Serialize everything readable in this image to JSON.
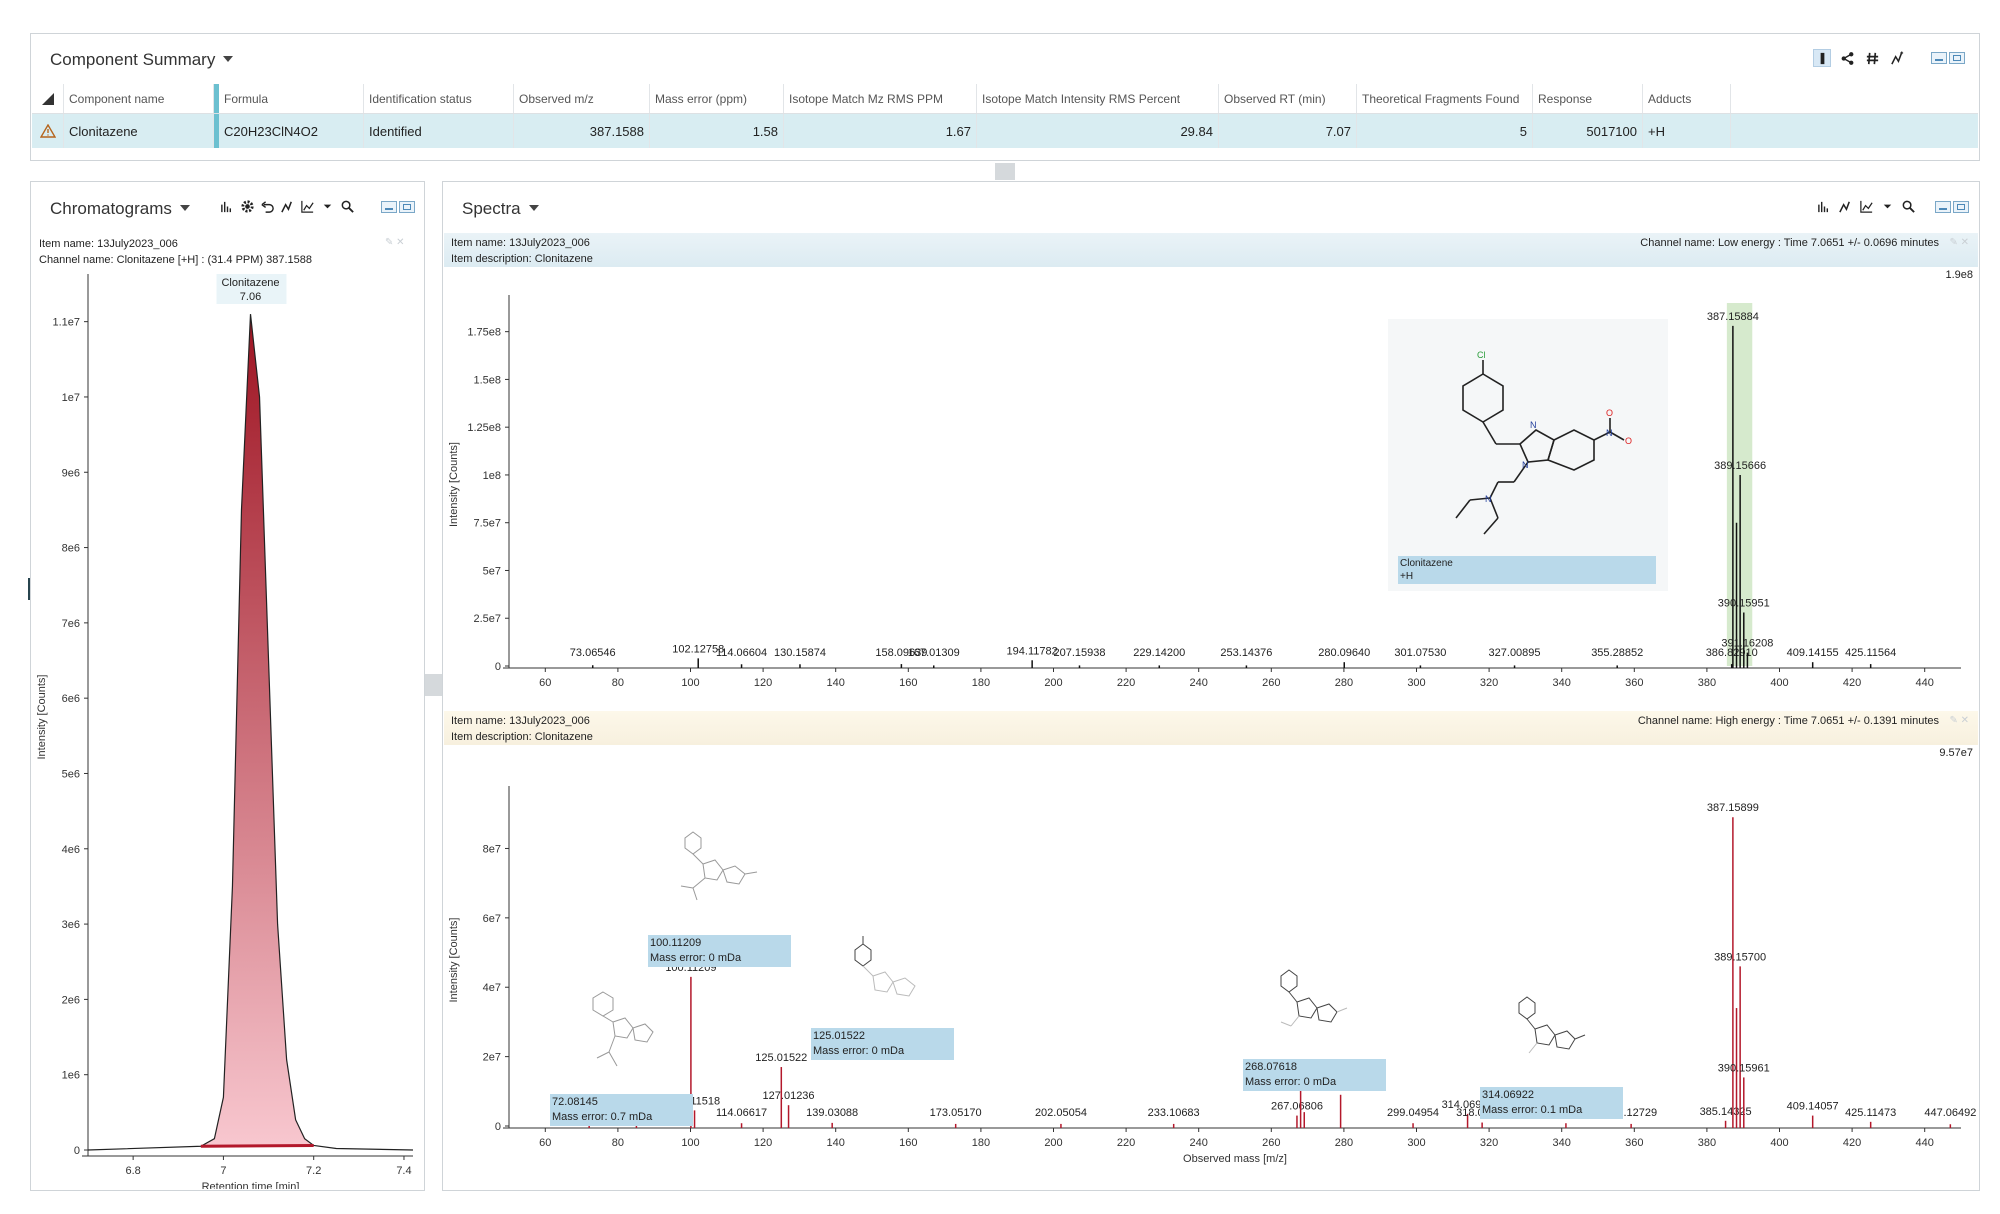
{
  "component_summary": {
    "title": "Component Summary",
    "columns": [
      "Component name",
      "Formula",
      "Identification status",
      "Observed m/z",
      "Mass error (ppm)",
      "Isotope Match Mz RMS PPM",
      "Isotope Match Intensity RMS Percent",
      "Observed RT (min)",
      "Theoretical Fragments Found",
      "Response",
      "Adducts"
    ],
    "row": {
      "name": "Clonitazene",
      "formula": "C20H23ClN4O2",
      "status": "Identified",
      "observed_mz": "387.1588",
      "mass_error": "1.58",
      "iso_mz": "1.67",
      "iso_int": "29.84",
      "rt": "7.07",
      "fragments": "5",
      "response": "5017100",
      "adducts": "+H"
    },
    "toolbar_icons": [
      "flask-icon",
      "share-icon",
      "hash-icon",
      "structure-icon"
    ]
  },
  "chromatograms": {
    "title": "Chromatograms",
    "item_name": "Item name: 13July2023_006",
    "channel_name": "Channel name: Clonitazene [+H] : (31.4 PPM) 387.1588",
    "peak_label": "Clonitazene",
    "peak_rt": "7.06",
    "ylabel": "Intensity [Counts]",
    "xlabel": "Retention time [min]"
  },
  "spectra": {
    "title": "Spectra",
    "low": {
      "item_name": "Item name: 13July2023_006",
      "item_desc": "Item description: Clonitazene",
      "channel": "Channel name: Low energy : Time 7.0651 +/- 0.0696 minutes",
      "max_label": "1.9e8",
      "ylabel": "Intensity [Counts]",
      "struct_label_1": "Clonitazene",
      "struct_label_2": "+H"
    },
    "high": {
      "item_name": "Item name: 13July2023_006",
      "item_desc": "Item description: Clonitazene",
      "channel": "Channel name: High energy : Time 7.0651 +/- 0.1391 minutes",
      "max_label": "9.57e7",
      "ylabel": "Intensity [Counts]",
      "xlabel": "Observed mass [m/z]",
      "callouts": [
        {
          "mz": "72.08145",
          "err": "Mass error: 0.7 mDa"
        },
        {
          "mz": "100.11209",
          "err": "Mass error: 0 mDa"
        },
        {
          "mz": "125.01522",
          "err": "Mass error: 0 mDa"
        },
        {
          "mz": "268.07618",
          "err": "Mass error: 0 mDa"
        },
        {
          "mz": "314.06922",
          "err": "Mass error: 0.1 mDa"
        }
      ]
    }
  },
  "chart_data": [
    {
      "type": "line",
      "title": "",
      "xlabel": "Retention time [min]",
      "ylabel": "Intensity [Counts]",
      "xlim": [
        6.7,
        7.42
      ],
      "ylim": [
        0,
        11500000
      ],
      "xticks": [
        "6.8",
        "7",
        "7.2",
        "7.4"
      ],
      "yticks": [
        "0",
        "1e6",
        "2e6",
        "3e6",
        "4e6",
        "5e6",
        "6e6",
        "7e6",
        "8e6",
        "9e6",
        "1e7",
        "1.1e7"
      ],
      "x": [
        6.7,
        6.95,
        6.98,
        7.0,
        7.02,
        7.04,
        7.06,
        7.08,
        7.1,
        7.12,
        7.14,
        7.16,
        7.18,
        7.2,
        7.25,
        7.42
      ],
      "y": [
        0,
        50000,
        150000,
        700000,
        3500000,
        8500000,
        11100000,
        10000000,
        6500000,
        3000000,
        1200000,
        400000,
        150000,
        60000,
        20000,
        0
      ],
      "annotations": [
        {
          "label": "Clonitazene",
          "x": 7.06,
          "text": "7.06"
        }
      ]
    },
    {
      "type": "bar",
      "title": "Low energy",
      "xlabel": "",
      "ylabel": "Intensity [Counts]",
      "xlim": [
        50,
        450
      ],
      "ylim": [
        0,
        190000000
      ],
      "xticks": [
        "60",
        "80",
        "100",
        "120",
        "140",
        "160",
        "180",
        "200",
        "220",
        "240",
        "260",
        "280",
        "300",
        "320",
        "340",
        "360",
        "380",
        "400",
        "420",
        "440"
      ],
      "yticks": [
        "0",
        "2.5e7",
        "5e7",
        "7.5e7",
        "1e8",
        "1.25e8",
        "1.5e8",
        "1.75e8"
      ],
      "peaks": [
        {
          "mz": 73.06546,
          "intensity": 400000,
          "label": "73.06546"
        },
        {
          "mz": 102.12758,
          "intensity": 4000000,
          "label": "102.12758"
        },
        {
          "mz": 114.06604,
          "intensity": 900000,
          "label": "114.06604"
        },
        {
          "mz": 130.15874,
          "intensity": 900000,
          "label": "130.15874"
        },
        {
          "mz": 158.09639,
          "intensity": 1000000,
          "label": "158.09639"
        },
        {
          "mz": 167.01309,
          "intensity": 300000,
          "label": "167.01309"
        },
        {
          "mz": 194.11782,
          "intensity": 3000000,
          "label": "194.11782"
        },
        {
          "mz": 207.15938,
          "intensity": 300000,
          "label": "207.15938"
        },
        {
          "mz": 229.142,
          "intensity": 300000,
          "label": "229.14200"
        },
        {
          "mz": 253.14376,
          "intensity": 300000,
          "label": "253.14376"
        },
        {
          "mz": 280.0964,
          "intensity": 2000000,
          "label": "280.09640"
        },
        {
          "mz": 301.0753,
          "intensity": 300000,
          "label": "301.07530"
        },
        {
          "mz": 327.00895,
          "intensity": 300000,
          "label": "327.00895"
        },
        {
          "mz": 355.28852,
          "intensity": 300000,
          "label": "355.28852"
        },
        {
          "mz": 386.8291,
          "intensity": 1000000,
          "label": "386.82910"
        },
        {
          "mz": 387.15884,
          "intensity": 178000000,
          "label": "387.15884"
        },
        {
          "mz": 388.16,
          "intensity": 75000000,
          "label": ""
        },
        {
          "mz": 389.15666,
          "intensity": 100000000,
          "label": "389.15666"
        },
        {
          "mz": 390.15951,
          "intensity": 28000000,
          "label": "390.15951"
        },
        {
          "mz": 391.16208,
          "intensity": 7000000,
          "label": "391.16208"
        },
        {
          "mz": 409.14155,
          "intensity": 2000000,
          "label": "409.14155"
        },
        {
          "mz": 425.11564,
          "intensity": 1000000,
          "label": "425.11564"
        }
      ]
    },
    {
      "type": "bar",
      "title": "High energy",
      "xlabel": "Observed mass [m/z]",
      "ylabel": "Intensity [Counts]",
      "xlim": [
        50,
        450
      ],
      "ylim": [
        0,
        95700000
      ],
      "xticks": [
        "60",
        "80",
        "100",
        "120",
        "140",
        "160",
        "180",
        "200",
        "220",
        "240",
        "260",
        "280",
        "300",
        "320",
        "340",
        "360",
        "380",
        "400",
        "420",
        "440"
      ],
      "yticks": [
        "0",
        "2e7",
        "4e7",
        "6e7",
        "8e7"
      ],
      "peaks": [
        {
          "mz": 72.08145,
          "intensity": 3500000,
          "label": "72.08145"
        },
        {
          "mz": 85.1,
          "intensity": 2000000,
          "label": ""
        },
        {
          "mz": 100.11209,
          "intensity": 43000000,
          "label": "100.11209"
        },
        {
          "mz": 101.11518,
          "intensity": 4500000,
          "label": "101.11518"
        },
        {
          "mz": 114.06617,
          "intensity": 800000,
          "label": "114.06617"
        },
        {
          "mz": 125.01522,
          "intensity": 17000000,
          "label": "125.01522"
        },
        {
          "mz": 127.01236,
          "intensity": 6000000,
          "label": "127.01236"
        },
        {
          "mz": 139.03088,
          "intensity": 900000,
          "label": "139.03088"
        },
        {
          "mz": 173.0517,
          "intensity": 600000,
          "label": "173.05170"
        },
        {
          "mz": 202.05054,
          "intensity": 600000,
          "label": "202.05054"
        },
        {
          "mz": 233.10683,
          "intensity": 600000,
          "label": "233.10683"
        },
        {
          "mz": 267.06806,
          "intensity": 3000000,
          "label": "267.06806"
        },
        {
          "mz": 268.07618,
          "intensity": 12500000,
          "label": "268.07618"
        },
        {
          "mz": 269.08,
          "intensity": 4000000,
          "label": ""
        },
        {
          "mz": 279.09367,
          "intensity": 9000000,
          "label": "279.09367"
        },
        {
          "mz": 299.04954,
          "intensity": 800000,
          "label": "299.04954"
        },
        {
          "mz": 314.06922,
          "intensity": 3500000,
          "label": "314.06922"
        },
        {
          "mz": 318.0792,
          "intensity": 1000000,
          "label": "318.07920"
        },
        {
          "mz": 341.16569,
          "intensity": 800000,
          "label": "341.16569"
        },
        {
          "mz": 359.12729,
          "intensity": 600000,
          "label": "359.12729"
        },
        {
          "mz": 385.14325,
          "intensity": 1500000,
          "label": "385.14325"
        },
        {
          "mz": 387.15899,
          "intensity": 89000000,
          "label": "387.15899"
        },
        {
          "mz": 388.16,
          "intensity": 34000000,
          "label": ""
        },
        {
          "mz": 389.157,
          "intensity": 46000000,
          "label": "389.15700"
        },
        {
          "mz": 390.15961,
          "intensity": 14000000,
          "label": "390.15961"
        },
        {
          "mz": 409.14057,
          "intensity": 3000000,
          "label": "409.14057"
        },
        {
          "mz": 425.11473,
          "intensity": 1200000,
          "label": "425.11473"
        },
        {
          "mz": 447.06492,
          "intensity": 500000,
          "label": "447.06492"
        }
      ]
    }
  ]
}
